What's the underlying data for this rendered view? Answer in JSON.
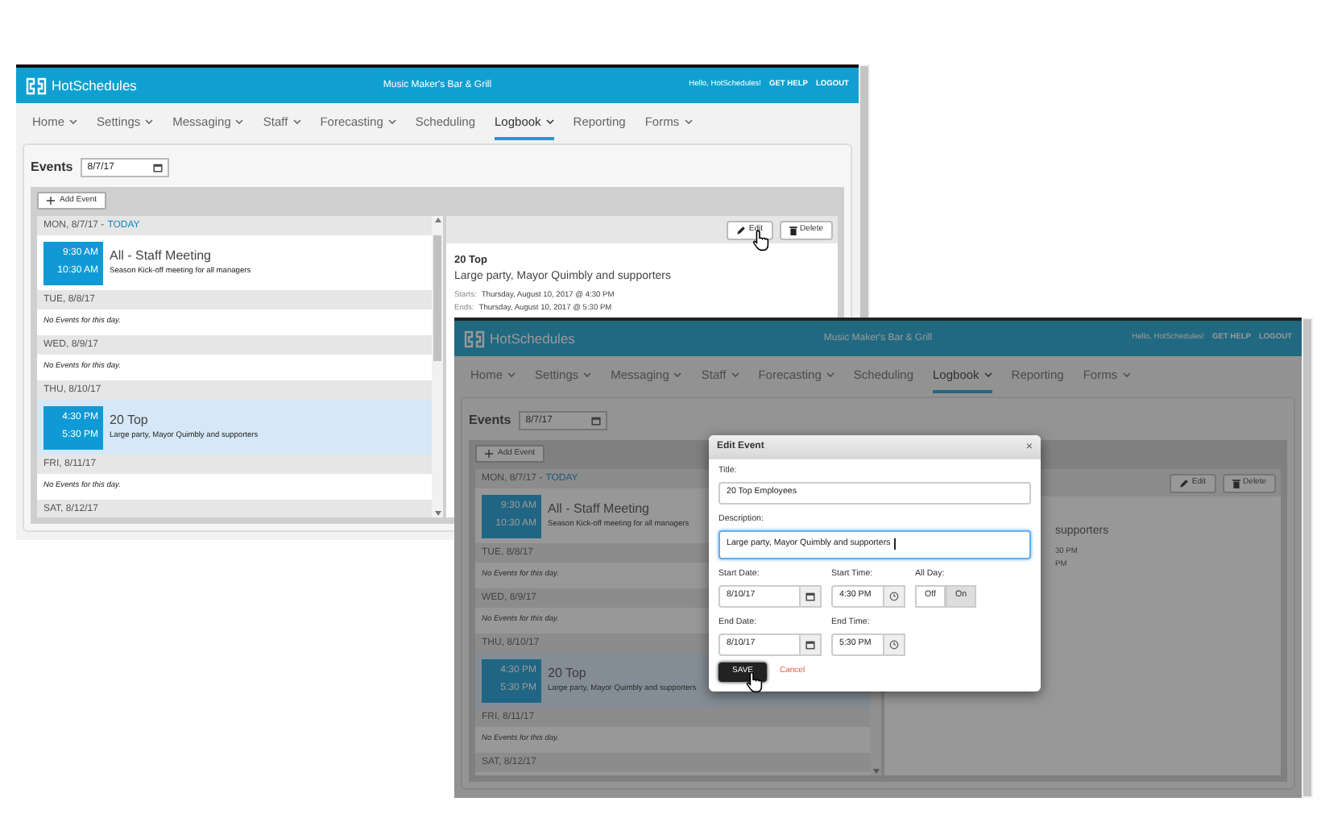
{
  "windows": [
    {
      "header": {
        "brand": "HotSchedules",
        "venue": "Music Maker's Bar & Grill",
        "greeting": "Hello, HotSchedules!",
        "links": [
          "GET HELP",
          "LOGOUT"
        ]
      },
      "nav": [
        {
          "label": "Home",
          "dropdown": true,
          "selected": false
        },
        {
          "label": "Settings",
          "dropdown": true,
          "selected": false
        },
        {
          "label": "Messaging",
          "dropdown": true,
          "selected": false
        },
        {
          "label": "Staff",
          "dropdown": true,
          "selected": false
        },
        {
          "label": "Forecasting",
          "dropdown": true,
          "selected": false
        },
        {
          "label": "Scheduling",
          "dropdown": false,
          "selected": false
        },
        {
          "label": "Logbook",
          "dropdown": true,
          "selected": true
        },
        {
          "label": "Reporting",
          "dropdown": false,
          "selected": false
        },
        {
          "label": "Forms",
          "dropdown": true,
          "selected": false
        }
      ],
      "section_title": "Events",
      "date": "8/7/17",
      "add_button": "Add Event",
      "days": [
        {
          "date": "MON, 8/7/17 -",
          "today": "TODAY",
          "events": [
            {
              "start": "9:30 AM",
              "end": "10:30 AM",
              "title": "All - Staff Meeting",
              "description": "Season Kick-off meeting for all managers",
              "selected": false
            }
          ]
        },
        {
          "date": "TUE, 8/8/17",
          "empty": "No Events for this day."
        },
        {
          "date": "WED, 8/9/17",
          "empty": "No Events for this day."
        },
        {
          "date": "THU, 8/10/17",
          "events": [
            {
              "start": "4:30 PM",
              "end": "5:30 PM",
              "title": "20 Top",
              "description": "Large party, Mayor Quimbly and supporters",
              "selected": true
            }
          ]
        },
        {
          "date": "FRI, 8/11/17",
          "empty": "No Events for this day."
        },
        {
          "date": "SAT, 8/12/17"
        }
      ],
      "detail": {
        "kind": "full",
        "buttons": [
          {
            "label": "Edit",
            "kind": "edit",
            "hovered": true
          },
          {
            "label": "Delete",
            "kind": "delete",
            "hovered": false
          }
        ],
        "title": "20 Top",
        "description": "Large party, Mayor Quimbly and supporters",
        "starts_label": "Starts:",
        "starts": "Thursday, August 10, 2017 @ 4:30 PM",
        "ends_label": "Ends:",
        "ends": "Thursday, August 10, 2017 @ 5:30 PM"
      }
    },
    {
      "header": {
        "brand": "HotSchedules",
        "venue": "Music Maker's Bar & Grill",
        "greeting": "Hello, HotSchedules!",
        "links": [
          "GET HELP",
          "LOGOUT"
        ]
      },
      "nav": [
        {
          "label": "Home",
          "dropdown": true,
          "selected": false
        },
        {
          "label": "Settings",
          "dropdown": true,
          "selected": false
        },
        {
          "label": "Messaging",
          "dropdown": true,
          "selected": false
        },
        {
          "label": "Staff",
          "dropdown": true,
          "selected": false
        },
        {
          "label": "Forecasting",
          "dropdown": true,
          "selected": false
        },
        {
          "label": "Scheduling",
          "dropdown": false,
          "selected": false
        },
        {
          "label": "Logbook",
          "dropdown": true,
          "selected": true
        },
        {
          "label": "Reporting",
          "dropdown": false,
          "selected": false
        },
        {
          "label": "Forms",
          "dropdown": true,
          "selected": false
        }
      ],
      "section_title": "Events",
      "date": "8/7/17",
      "add_button": "Add Event",
      "days": [
        {
          "date": "MON, 8/7/17 -",
          "today": "TODAY",
          "events": [
            {
              "start": "9:30 AM",
              "end": "10:30 AM",
              "title": "All - Staff Meeting",
              "description": "Season Kick-off meeting for all managers",
              "selected": false
            }
          ]
        },
        {
          "date": "TUE, 8/8/17",
          "empty": "No Events for this day."
        },
        {
          "date": "WED, 8/9/17",
          "empty": "No Events for this day."
        },
        {
          "date": "THU, 8/10/17",
          "events": [
            {
              "start": "4:30 PM",
              "end": "5:30 PM",
              "title": "20 Top",
              "description": "Large party, Mayor Quimbly and supporters",
              "selected": true
            }
          ]
        },
        {
          "date": "FRI, 8/11/17",
          "empty": "No Events for this day."
        },
        {
          "date": "SAT, 8/12/17"
        }
      ],
      "detail": {
        "kind": "partial",
        "buttons": [
          {
            "label": "Edit",
            "kind": "edit",
            "hovered": false
          },
          {
            "label": "Delete",
            "kind": "delete",
            "hovered": false
          }
        ],
        "description": "supporters",
        "starts": "30 PM",
        "ends": "PM"
      },
      "modal": {
        "title": "Edit Event",
        "close": "×",
        "rows": [
          [
            {
              "kind": "text",
              "label": "Title:",
              "value": "20 Top Employees",
              "focused": false
            }
          ],
          [
            {
              "kind": "textarea",
              "label": "Description:",
              "value": "Large party, Mayor Quimbly and supporters",
              "focused": true
            }
          ],
          [
            {
              "kind": "date",
              "label": "Start Date:",
              "value": "8/10/17"
            },
            {
              "kind": "time",
              "label": "Start Time:",
              "value": "4:30 PM"
            },
            {
              "kind": "toggle",
              "label": "All Day:",
              "options": [
                {
                  "label": "Off",
                  "selected": false
                },
                {
                  "label": "On",
                  "selected": true
                }
              ]
            }
          ],
          [
            {
              "kind": "date",
              "label": "End Date:",
              "value": "8/10/17"
            },
            {
              "kind": "time",
              "label": "End Time:",
              "value": "5:30 PM"
            }
          ]
        ],
        "save": {
          "label": "SAVE",
          "hovered": true
        },
        "cancel": "Cancel"
      }
    }
  ]
}
